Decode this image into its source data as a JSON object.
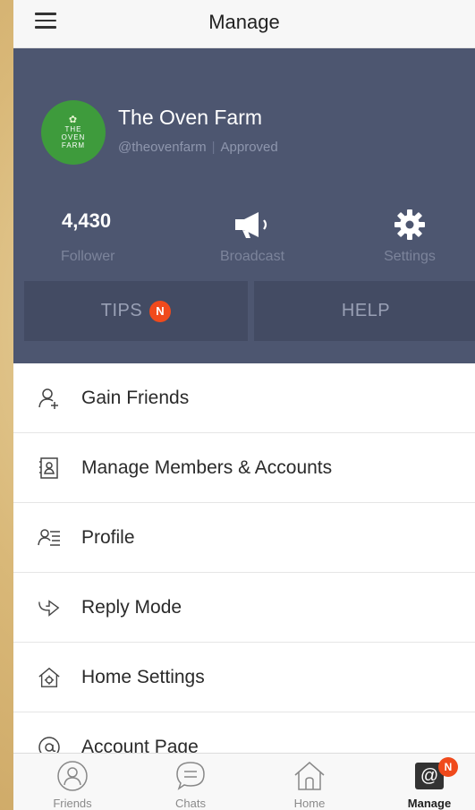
{
  "topbar": {
    "title": "Manage",
    "menu_icon": "hamburger-icon"
  },
  "profile": {
    "name": "The Oven Farm",
    "handle": "@theovenfarm",
    "status": "Approved",
    "logo_text": [
      "THE",
      "OVEN",
      "FARM"
    ]
  },
  "stats": {
    "followers_value": "4,430",
    "followers_label": "Follower",
    "broadcast_label": "Broadcast",
    "settings_label": "Settings"
  },
  "tabs": {
    "tips_label": "TIPS",
    "tips_badge": "N",
    "help_label": "HELP"
  },
  "menu": {
    "items": [
      {
        "label": "Gain Friends",
        "icon": "add-person-icon"
      },
      {
        "label": "Manage Members & Accounts",
        "icon": "member-card-icon"
      },
      {
        "label": "Profile",
        "icon": "profile-list-icon"
      },
      {
        "label": "Reply Mode",
        "icon": "reply-arrow-icon"
      },
      {
        "label": "Home Settings",
        "icon": "home-gear-icon"
      },
      {
        "label": "Account Page",
        "icon": "at-circle-icon"
      }
    ]
  },
  "bottomnav": {
    "friends_label": "Friends",
    "chats_label": "Chats",
    "home_label": "Home",
    "manage_label": "Manage",
    "manage_badge": "N"
  },
  "colors": {
    "card_bg": "#4d5670",
    "tab_bg": "#434b63",
    "badge": "#f04a1c",
    "avatar_green": "#3e9b3c"
  }
}
